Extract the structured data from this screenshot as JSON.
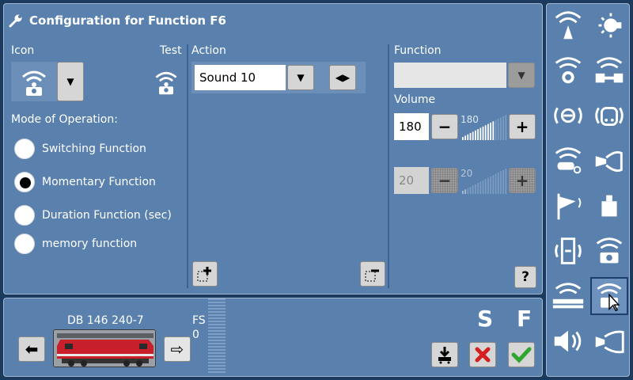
{
  "header": {
    "title": "Configuration for Function F6"
  },
  "icon_section": {
    "label": "Icon",
    "test_label": "Test"
  },
  "mode": {
    "label": "Mode of Operation:",
    "options": [
      {
        "label": "Switching Function",
        "selected": false
      },
      {
        "label": "Momentary Function",
        "selected": true
      },
      {
        "label": "Duration Function (sec)",
        "selected": false
      },
      {
        "label": "memory function",
        "selected": false
      }
    ]
  },
  "action": {
    "label": "Action",
    "value": "Sound 10"
  },
  "function_section": {
    "label": "Function",
    "value": "",
    "volume_label": "Volume",
    "volume_value": "180",
    "volume_level": "180",
    "second_value": "20",
    "second_level": "20"
  },
  "loco": {
    "name": "DB 146 240-7",
    "fs_label": "FS",
    "fs_value": "0"
  },
  "footer": {
    "s_label": "S",
    "f_label": "F"
  },
  "colors": {
    "panel": "#5a81ad",
    "background": "#1c3a5e",
    "accent_red": "#d42020",
    "accent_green": "#2fa62f"
  },
  "sidebar_icons": [
    "fan-sound-icon",
    "light-bulb-icon",
    "cab-light-sound-icon",
    "coupler-sound-icon",
    "brake-squeal-icon",
    "compressor-sound-icon",
    "whistle-sound-icon",
    "horn-sound-icon",
    "flag-icon",
    "weight-icon",
    "door-sound-icon",
    "generic-sound-icon",
    "platform-announcement-icon",
    "sound-icon-selected",
    "volume-icon",
    "horn-icon"
  ]
}
